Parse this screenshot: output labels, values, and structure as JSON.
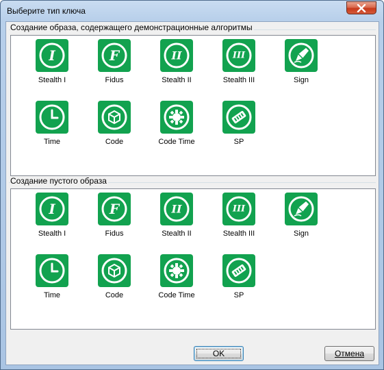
{
  "window": {
    "title": "Выберите тип ключа",
    "close_icon": "close-icon"
  },
  "groups": [
    {
      "label": "Создание образа, содержащего демонстрационные алгоритмы",
      "items": [
        {
          "label": "Stealth I",
          "icon": "stealth-i-icon",
          "glyph": "I"
        },
        {
          "label": "Fidus",
          "icon": "fidus-icon",
          "glyph": "F"
        },
        {
          "label": "Stealth II",
          "icon": "stealth-ii-icon",
          "glyph": "II"
        },
        {
          "label": "Stealth III",
          "icon": "stealth-iii-icon",
          "glyph": "III"
        },
        {
          "label": "Sign",
          "icon": "sign-icon",
          "glyph": ""
        },
        {
          "label": "Time",
          "icon": "time-icon",
          "glyph": ""
        },
        {
          "label": "Code",
          "icon": "code-icon",
          "glyph": ""
        },
        {
          "label": "Code Time",
          "icon": "code-time-icon",
          "glyph": ""
        },
        {
          "label": "SP",
          "icon": "sp-icon",
          "glyph": ""
        }
      ]
    },
    {
      "label": "Создание пустого образа",
      "items": [
        {
          "label": "Stealth I",
          "icon": "stealth-i-icon",
          "glyph": "I"
        },
        {
          "label": "Fidus",
          "icon": "fidus-icon",
          "glyph": "F"
        },
        {
          "label": "Stealth II",
          "icon": "stealth-ii-icon",
          "glyph": "II"
        },
        {
          "label": "Stealth III",
          "icon": "stealth-iii-icon",
          "glyph": "III"
        },
        {
          "label": "Sign",
          "icon": "sign-icon",
          "glyph": ""
        },
        {
          "label": "Time",
          "icon": "time-icon",
          "glyph": ""
        },
        {
          "label": "Code",
          "icon": "code-icon",
          "glyph": ""
        },
        {
          "label": "Code Time",
          "icon": "code-time-icon",
          "glyph": ""
        },
        {
          "label": "SP",
          "icon": "sp-icon",
          "glyph": ""
        }
      ]
    }
  ],
  "buttons": {
    "ok": "OK",
    "cancel": "Отмена"
  },
  "colors": {
    "icon_green": "#12a24f",
    "title_gradient": "#b7cfea"
  }
}
